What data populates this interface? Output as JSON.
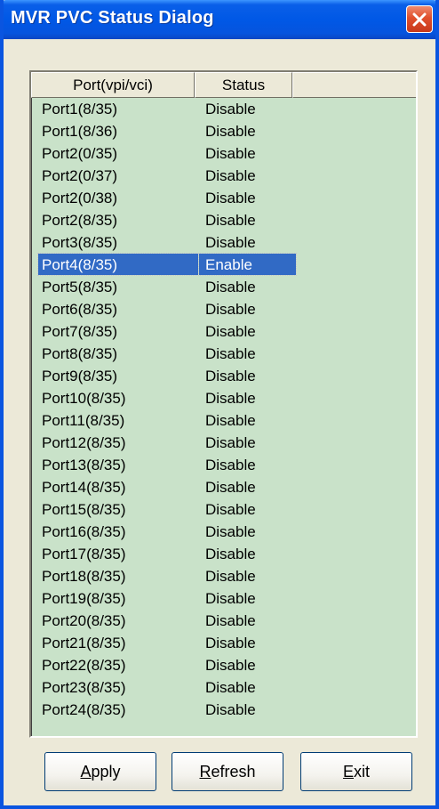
{
  "window": {
    "title": "MVR PVC Status Dialog"
  },
  "colors": {
    "titlebar": "#0058e6",
    "list_background": "#c9e2c9",
    "selection": "#316ac5",
    "close_button": "#e0502d"
  },
  "list": {
    "columns": [
      "Port(vpi/vci)",
      "Status",
      ""
    ],
    "selected_index": 7,
    "rows": [
      {
        "port": "Port1(8/35)",
        "status": "Disable"
      },
      {
        "port": "Port1(8/36)",
        "status": "Disable"
      },
      {
        "port": "Port2(0/35)",
        "status": "Disable"
      },
      {
        "port": "Port2(0/37)",
        "status": "Disable"
      },
      {
        "port": "Port2(0/38)",
        "status": "Disable"
      },
      {
        "port": "Port2(8/35)",
        "status": "Disable"
      },
      {
        "port": "Port3(8/35)",
        "status": "Disable"
      },
      {
        "port": "Port4(8/35)",
        "status": "Enable"
      },
      {
        "port": "Port5(8/35)",
        "status": "Disable"
      },
      {
        "port": "Port6(8/35)",
        "status": "Disable"
      },
      {
        "port": "Port7(8/35)",
        "status": "Disable"
      },
      {
        "port": "Port8(8/35)",
        "status": "Disable"
      },
      {
        "port": "Port9(8/35)",
        "status": "Disable"
      },
      {
        "port": "Port10(8/35)",
        "status": "Disable"
      },
      {
        "port": "Port11(8/35)",
        "status": "Disable"
      },
      {
        "port": "Port12(8/35)",
        "status": "Disable"
      },
      {
        "port": "Port13(8/35)",
        "status": "Disable"
      },
      {
        "port": "Port14(8/35)",
        "status": "Disable"
      },
      {
        "port": "Port15(8/35)",
        "status": "Disable"
      },
      {
        "port": "Port16(8/35)",
        "status": "Disable"
      },
      {
        "port": "Port17(8/35)",
        "status": "Disable"
      },
      {
        "port": "Port18(8/35)",
        "status": "Disable"
      },
      {
        "port": "Port19(8/35)",
        "status": "Disable"
      },
      {
        "port": "Port20(8/35)",
        "status": "Disable"
      },
      {
        "port": "Port21(8/35)",
        "status": "Disable"
      },
      {
        "port": "Port22(8/35)",
        "status": "Disable"
      },
      {
        "port": "Port23(8/35)",
        "status": "Disable"
      },
      {
        "port": "Port24(8/35)",
        "status": "Disable"
      }
    ]
  },
  "buttons": {
    "apply": {
      "mnemonic": "A",
      "rest": "pply"
    },
    "refresh": {
      "mnemonic": "R",
      "rest": "efresh"
    },
    "exit": {
      "mnemonic": "E",
      "rest": "xit"
    }
  },
  "icons": {
    "close": "close-icon"
  }
}
